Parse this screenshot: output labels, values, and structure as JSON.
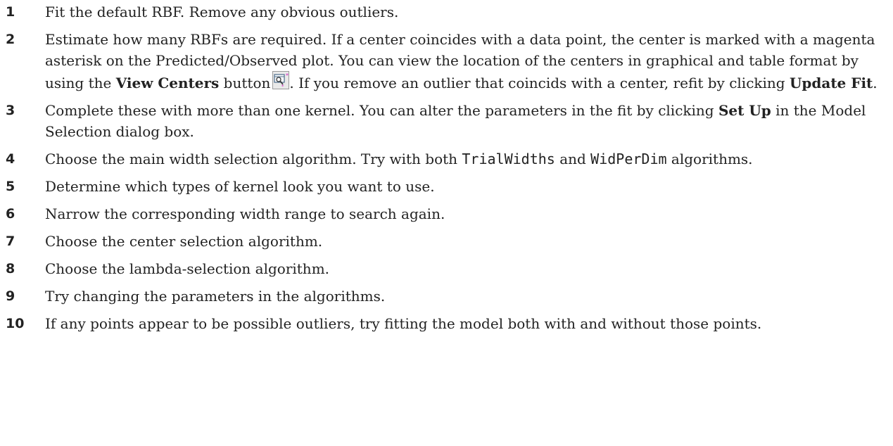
{
  "steps": [
    {
      "number": "1",
      "text": "Fit the default RBF. Remove any obvious outliers."
    },
    {
      "number": "2",
      "text_a": "Estimate how many RBFs are required. If a center coincides with a data point, the center is marked with a magenta asterisk on the Predicted/Observed plot. You can view the location of the centers in graphical and table format by using the ",
      "bold_a": "View Centers",
      "text_b": " button",
      "icon": "view-centers-icon",
      "text_c": ". If you remove an outlier that coincids with a center, refit by clicking ",
      "bold_b": "Update Fit",
      "text_d": "."
    },
    {
      "number": "3",
      "text_a": "Complete these with more than one kernel. You can alter the parameters in the fit by clicking ",
      "bold_a": "Set Up",
      "text_b": " in the Model Selection dialog box."
    },
    {
      "number": "4",
      "text_a": "Choose the main width selection algorithm. Try with both ",
      "code_a": "TrialWidths",
      "text_b": " and ",
      "code_b": "WidPerDim",
      "text_c": " algorithms."
    },
    {
      "number": "5",
      "text": "Determine which types of kernel look you want to use."
    },
    {
      "number": "6",
      "text": "Narrow the corresponding width range to search again."
    },
    {
      "number": "7",
      "text": "Choose the center selection algorithm."
    },
    {
      "number": "8",
      "text": "Choose the lambda-selection algorithm."
    },
    {
      "number": "9",
      "text": "Try changing the parameters in the algorithms."
    },
    {
      "number": "10",
      "text": "If any points appear to be possible outliers, try fitting the model both with and without those points."
    }
  ]
}
